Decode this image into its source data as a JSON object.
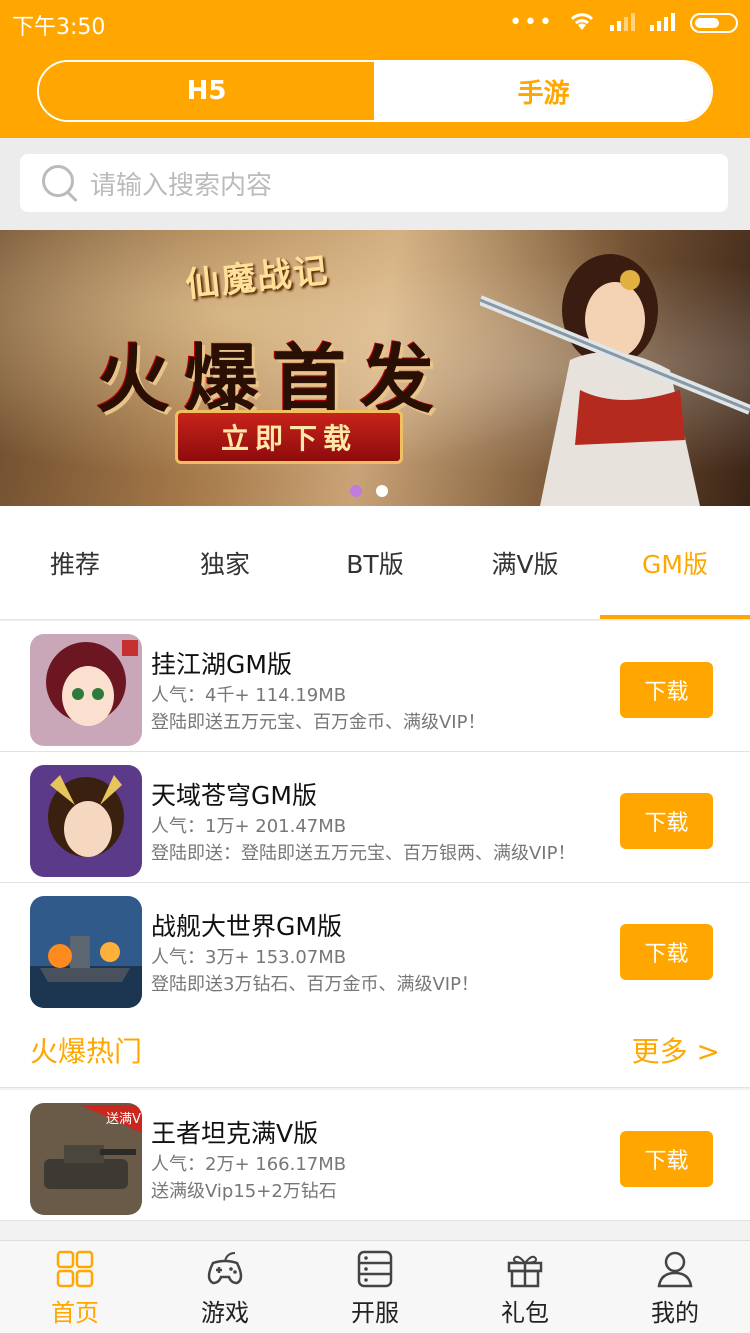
{
  "status": {
    "time": "下午3:50"
  },
  "segment": {
    "left": "H5",
    "right": "手游"
  },
  "search": {
    "placeholder": "请输入搜索内容"
  },
  "banner": {
    "logo_text": "仙魔战记",
    "headline": "火爆首发",
    "cta": "立即下载",
    "pager": {
      "count": 2,
      "active_index": 0
    }
  },
  "tabs": [
    {
      "label": "推荐"
    },
    {
      "label": "独家"
    },
    {
      "label": "BT版"
    },
    {
      "label": "满V版"
    },
    {
      "label": "GM版",
      "active": true
    }
  ],
  "games": [
    {
      "name": "挂江湖GM版",
      "meta": "人气：4千+ 114.19MB",
      "desc": "登陆即送五万元宝、百万金币、满级VIP！",
      "button": "下载",
      "icon": "girl-warrior-avatar"
    },
    {
      "name": "天域苍穹GM版",
      "meta": "人气：1万+ 201.47MB",
      "desc": "登陆即送：登陆即送五万元宝、百万银两、满级VIP！",
      "button": "下载",
      "icon": "fairy-girl-avatar"
    },
    {
      "name": "战舰大世界GM版",
      "meta": "人气：3万+ 153.07MB",
      "desc": "登陆即送3万钻石、百万金币、满级VIP！",
      "button": "下载",
      "icon": "battleship-avatar"
    }
  ],
  "hot_section": {
    "title": "火爆热门",
    "more": "更多 >"
  },
  "hot_games": [
    {
      "name": "王者坦克满V版",
      "meta": "人气：2万+ 166.17MB",
      "desc": "送满级Vip15+2万钻石",
      "button": "下载",
      "icon": "tank-avatar",
      "badge": "送满V"
    }
  ],
  "nav": [
    {
      "label": "首页",
      "icon": "home-grid-icon",
      "active": true
    },
    {
      "label": "游戏",
      "icon": "gamepad-icon"
    },
    {
      "label": "开服",
      "icon": "server-icon"
    },
    {
      "label": "礼包",
      "icon": "gift-icon"
    },
    {
      "label": "我的",
      "icon": "user-icon"
    }
  ],
  "colors": {
    "accent": "#ffa700",
    "pager_active": "#c07ae0"
  }
}
